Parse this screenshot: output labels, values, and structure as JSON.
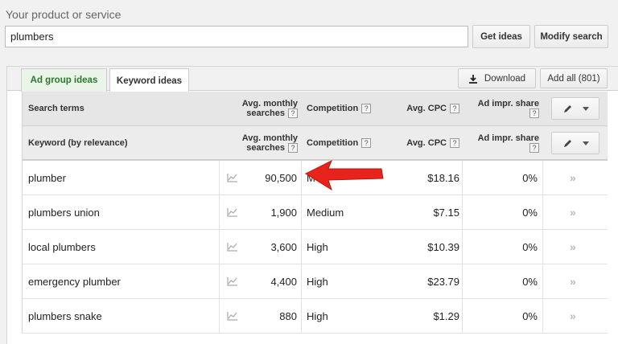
{
  "search": {
    "label": "Your product or service",
    "value": "plumbers",
    "get_ideas": "Get ideas",
    "modify_search": "Modify search"
  },
  "tabs": [
    {
      "label": "Ad group ideas",
      "active": false
    },
    {
      "label": "Keyword ideas",
      "active": true
    }
  ],
  "toolbar": {
    "download": "Download",
    "add_all": "Add all (801)"
  },
  "header_search_terms": {
    "term": "Search terms",
    "avg_line1": "Avg. monthly",
    "avg_line2": "searches",
    "competition": "Competition",
    "cpc": "Avg. CPC",
    "impr_line1": "Ad impr. share"
  },
  "header_keywords": {
    "term": "Keyword (by relevance)",
    "avg_line1": "Avg. monthly",
    "avg_line2": "searches",
    "competition": "Competition",
    "cpc": "Avg. CPC",
    "impr_line1": "Ad impr. share"
  },
  "help_glyph": "?",
  "add_glyph": "»",
  "rows": [
    {
      "keyword": "plumber",
      "searches": "90,500",
      "competition": "M",
      "cpc": "$18.16",
      "impr": "0%"
    },
    {
      "keyword": "plumbers union",
      "searches": "1,900",
      "competition": "Medium",
      "cpc": "$7.15",
      "impr": "0%"
    },
    {
      "keyword": "local plumbers",
      "searches": "3,600",
      "competition": "High",
      "cpc": "$10.39",
      "impr": "0%"
    },
    {
      "keyword": "emergency plumber",
      "searches": "4,400",
      "competition": "High",
      "cpc": "$23.79",
      "impr": "0%"
    },
    {
      "keyword": "plumbers snake",
      "searches": "880",
      "competition": "High",
      "cpc": "$1.29",
      "impr": "0%"
    }
  ],
  "colors": {
    "arrow": "#e8231c",
    "active_tab_text": "#2a7a2a"
  },
  "icons": {
    "download": "download-icon",
    "edit": "pencil-icon",
    "trend": "trend-chart-icon",
    "add": "double-chevron-right-icon"
  }
}
